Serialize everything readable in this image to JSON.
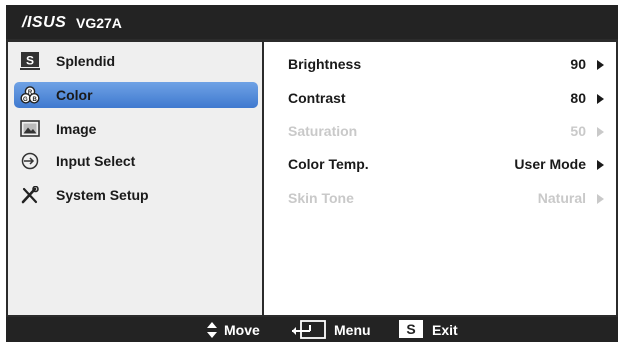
{
  "header": {
    "brand": "/ISUS",
    "model": "VG27A"
  },
  "menu": {
    "items": [
      {
        "label": "Splendid",
        "icon": "splendid-s-icon",
        "selected": false
      },
      {
        "label": "Color",
        "icon": "color-rgb-icon",
        "selected": true
      },
      {
        "label": "Image",
        "icon": "image-icon",
        "selected": false
      },
      {
        "label": "Input Select",
        "icon": "input-select-icon",
        "selected": false
      },
      {
        "label": "System Setup",
        "icon": "tools-icon",
        "selected": false
      }
    ]
  },
  "settings": {
    "rows": [
      {
        "label": "Brightness",
        "value": "90",
        "enabled": true
      },
      {
        "label": "Contrast",
        "value": "80",
        "enabled": true
      },
      {
        "label": "Saturation",
        "value": "50",
        "enabled": false
      },
      {
        "label": "Color Temp.",
        "value": "User Mode",
        "enabled": true
      },
      {
        "label": "Skin Tone",
        "value": "Natural",
        "enabled": false
      }
    ]
  },
  "footer": {
    "move_label": "Move",
    "menu_label": "Menu",
    "exit_label": "Exit",
    "exit_key": "S"
  },
  "colors": {
    "selected_accent": "#4a84d6",
    "frame": "#2b2b2b",
    "disabled_text": "#c9c9c9"
  }
}
